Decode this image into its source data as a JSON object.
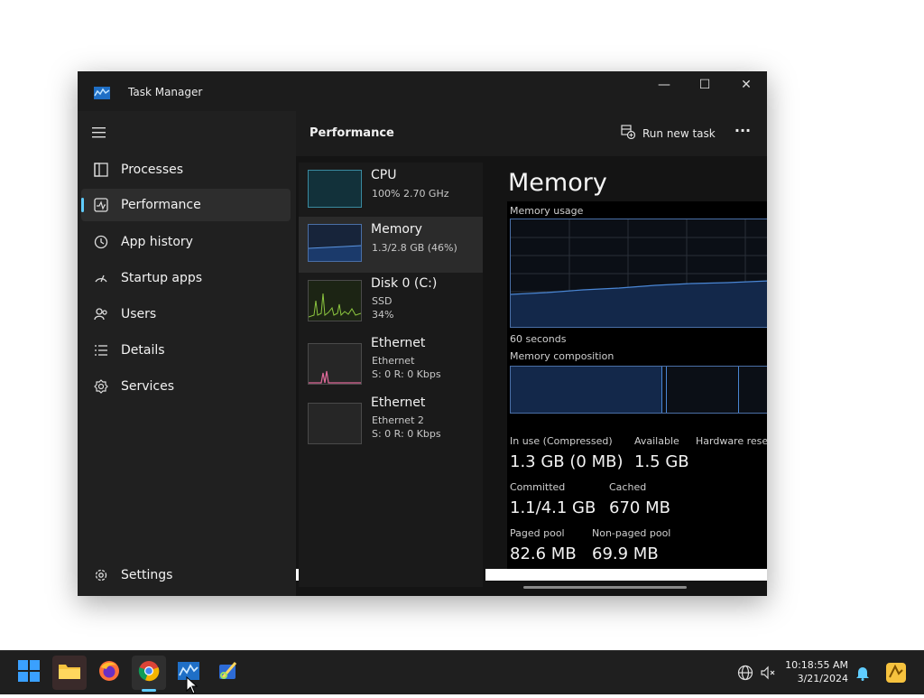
{
  "window": {
    "title": "Task Manager",
    "controls": {
      "minimize": "—",
      "maximize": "☐",
      "close": "✕"
    }
  },
  "sidebar": {
    "items": [
      {
        "label": "Processes",
        "icon": "processes-icon"
      },
      {
        "label": "Performance",
        "icon": "performance-icon",
        "active": true
      },
      {
        "label": "App history",
        "icon": "history-icon"
      },
      {
        "label": "Startup apps",
        "icon": "startup-icon"
      },
      {
        "label": "Users",
        "icon": "users-icon"
      },
      {
        "label": "Details",
        "icon": "details-icon"
      },
      {
        "label": "Services",
        "icon": "services-icon"
      }
    ],
    "settings_label": "Settings"
  },
  "header": {
    "title": "Performance",
    "run_new_task": "Run new task",
    "more": "···"
  },
  "devices": [
    {
      "title": "CPU",
      "sub1": "100%  2.70 GHz",
      "sub2": ""
    },
    {
      "title": "Memory",
      "sub1": "1.3/2.8 GB (46%)",
      "sub2": ""
    },
    {
      "title": "Disk 0 (C:)",
      "sub1": "SSD",
      "sub2": "34%"
    },
    {
      "title": "Ethernet",
      "sub1": "Ethernet",
      "sub2": "S: 0 R: 0 Kbps"
    },
    {
      "title": "Ethernet",
      "sub1": "Ethernet 2",
      "sub2": "S: 0 R: 0 Kbps"
    }
  ],
  "detail": {
    "title": "Memory",
    "usage_label": "Memory usage",
    "time_label": "60 seconds",
    "composition_label": "Memory composition",
    "stats": {
      "in_use_label": "In use (Compressed)",
      "in_use_value": "1.3 GB (0 MB)",
      "available_label": "Available",
      "available_value": "1.5 GB",
      "hardware_label": "Hardware reser",
      "committed_label": "Committed",
      "committed_value": "1.1/4.1 GB",
      "cached_label": "Cached",
      "cached_value": "670 MB",
      "paged_label": "Paged pool",
      "paged_value": "82.6 MB",
      "nonpaged_label": "Non-paged pool",
      "nonpaged_value": "69.9 MB"
    }
  },
  "taskbar": {
    "apps": [
      "start-icon",
      "file-explorer-icon",
      "firefox-icon",
      "chrome-icon",
      "task-manager-icon",
      "snipping-tool-icon"
    ],
    "time": "10:18:55 AM",
    "date": "3/21/2024"
  },
  "colors": {
    "accent": "#60cdff",
    "graph_fill": "#13284a",
    "graph_line": "#4a86d4"
  }
}
